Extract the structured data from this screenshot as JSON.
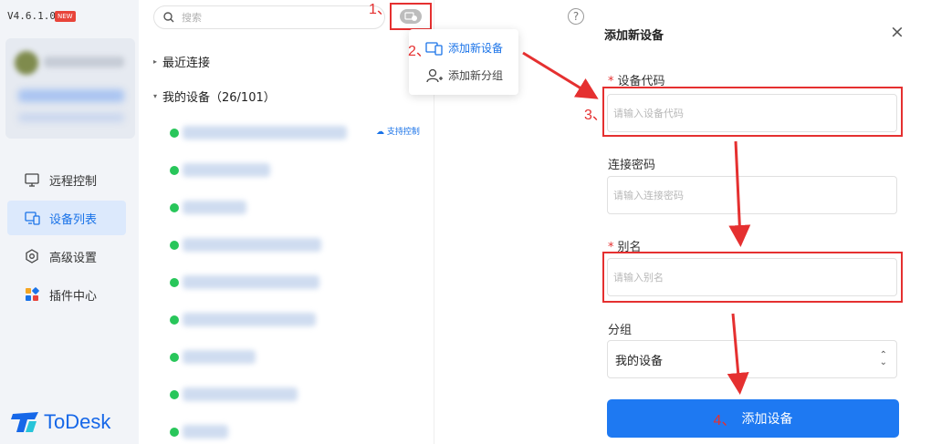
{
  "app": {
    "version": "V4.6.1.0",
    "new_badge": "NEW",
    "logo_text": "ToDesk",
    "brand_color": "#1667e8"
  },
  "sidebar": {
    "items": [
      {
        "label": "远程控制",
        "icon": "monitor-icon",
        "active": false
      },
      {
        "label": "设备列表",
        "icon": "devices-icon",
        "active": true
      },
      {
        "label": "高级设置",
        "icon": "settings-icon",
        "active": false
      },
      {
        "label": "插件中心",
        "icon": "plugins-icon",
        "active": false
      }
    ]
  },
  "device_panel": {
    "search_placeholder": "搜索",
    "recent_group": "最近连接",
    "my_devices_group": "我的设备（26/101）",
    "support_control": "支持控制",
    "online_color": "#28c65a"
  },
  "dropdown": {
    "add_device": "添加新设备",
    "add_group": "添加新分组"
  },
  "annotations": {
    "step1": "1、",
    "step2": "2、",
    "step3": "3、",
    "step4": "4、",
    "color": "#e53030"
  },
  "form": {
    "title": "添加新设备",
    "close": "×",
    "device_code_label": "设备代码",
    "device_code_placeholder": "请输入设备代码",
    "password_label": "连接密码",
    "password_placeholder": "请输入连接密码",
    "alias_label": "别名",
    "alias_placeholder": "请输入别名",
    "group_label": "分组",
    "group_value": "我的设备",
    "required_mark": "*",
    "submit": "添加设备",
    "submit_color": "#1e79f2"
  }
}
